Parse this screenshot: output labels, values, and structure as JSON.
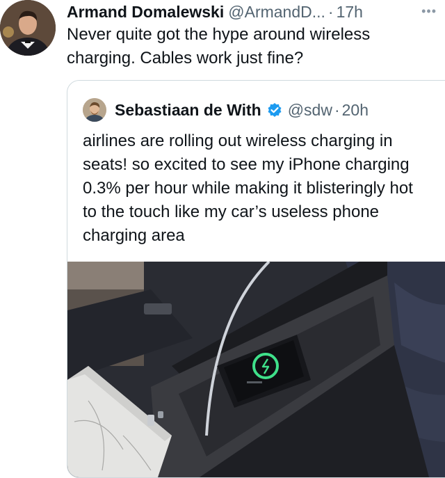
{
  "author": {
    "name": "Armand Domalewski",
    "handle": "@ArmandD...",
    "separator": "·",
    "time": "17h"
  },
  "more_label": "•••",
  "tweet": {
    "text": "Never quite got the hype around wireless charging. Cables work just fine?"
  },
  "quote": {
    "name": "Sebastiaan de With",
    "handle": "@sdw",
    "separator": "·",
    "time": "20h",
    "text": "airlines are rolling out wireless charging in seats! so excited to see my iPhone charging 0.3% per hour while making it blisteringly hot to the touch like my car’s useless phone charging area"
  },
  "colors": {
    "verified": "#1d9bf0",
    "charge_ring": "#3fe08a"
  },
  "icons": {
    "more": "more-icon",
    "verified": "verified-badge-icon"
  }
}
